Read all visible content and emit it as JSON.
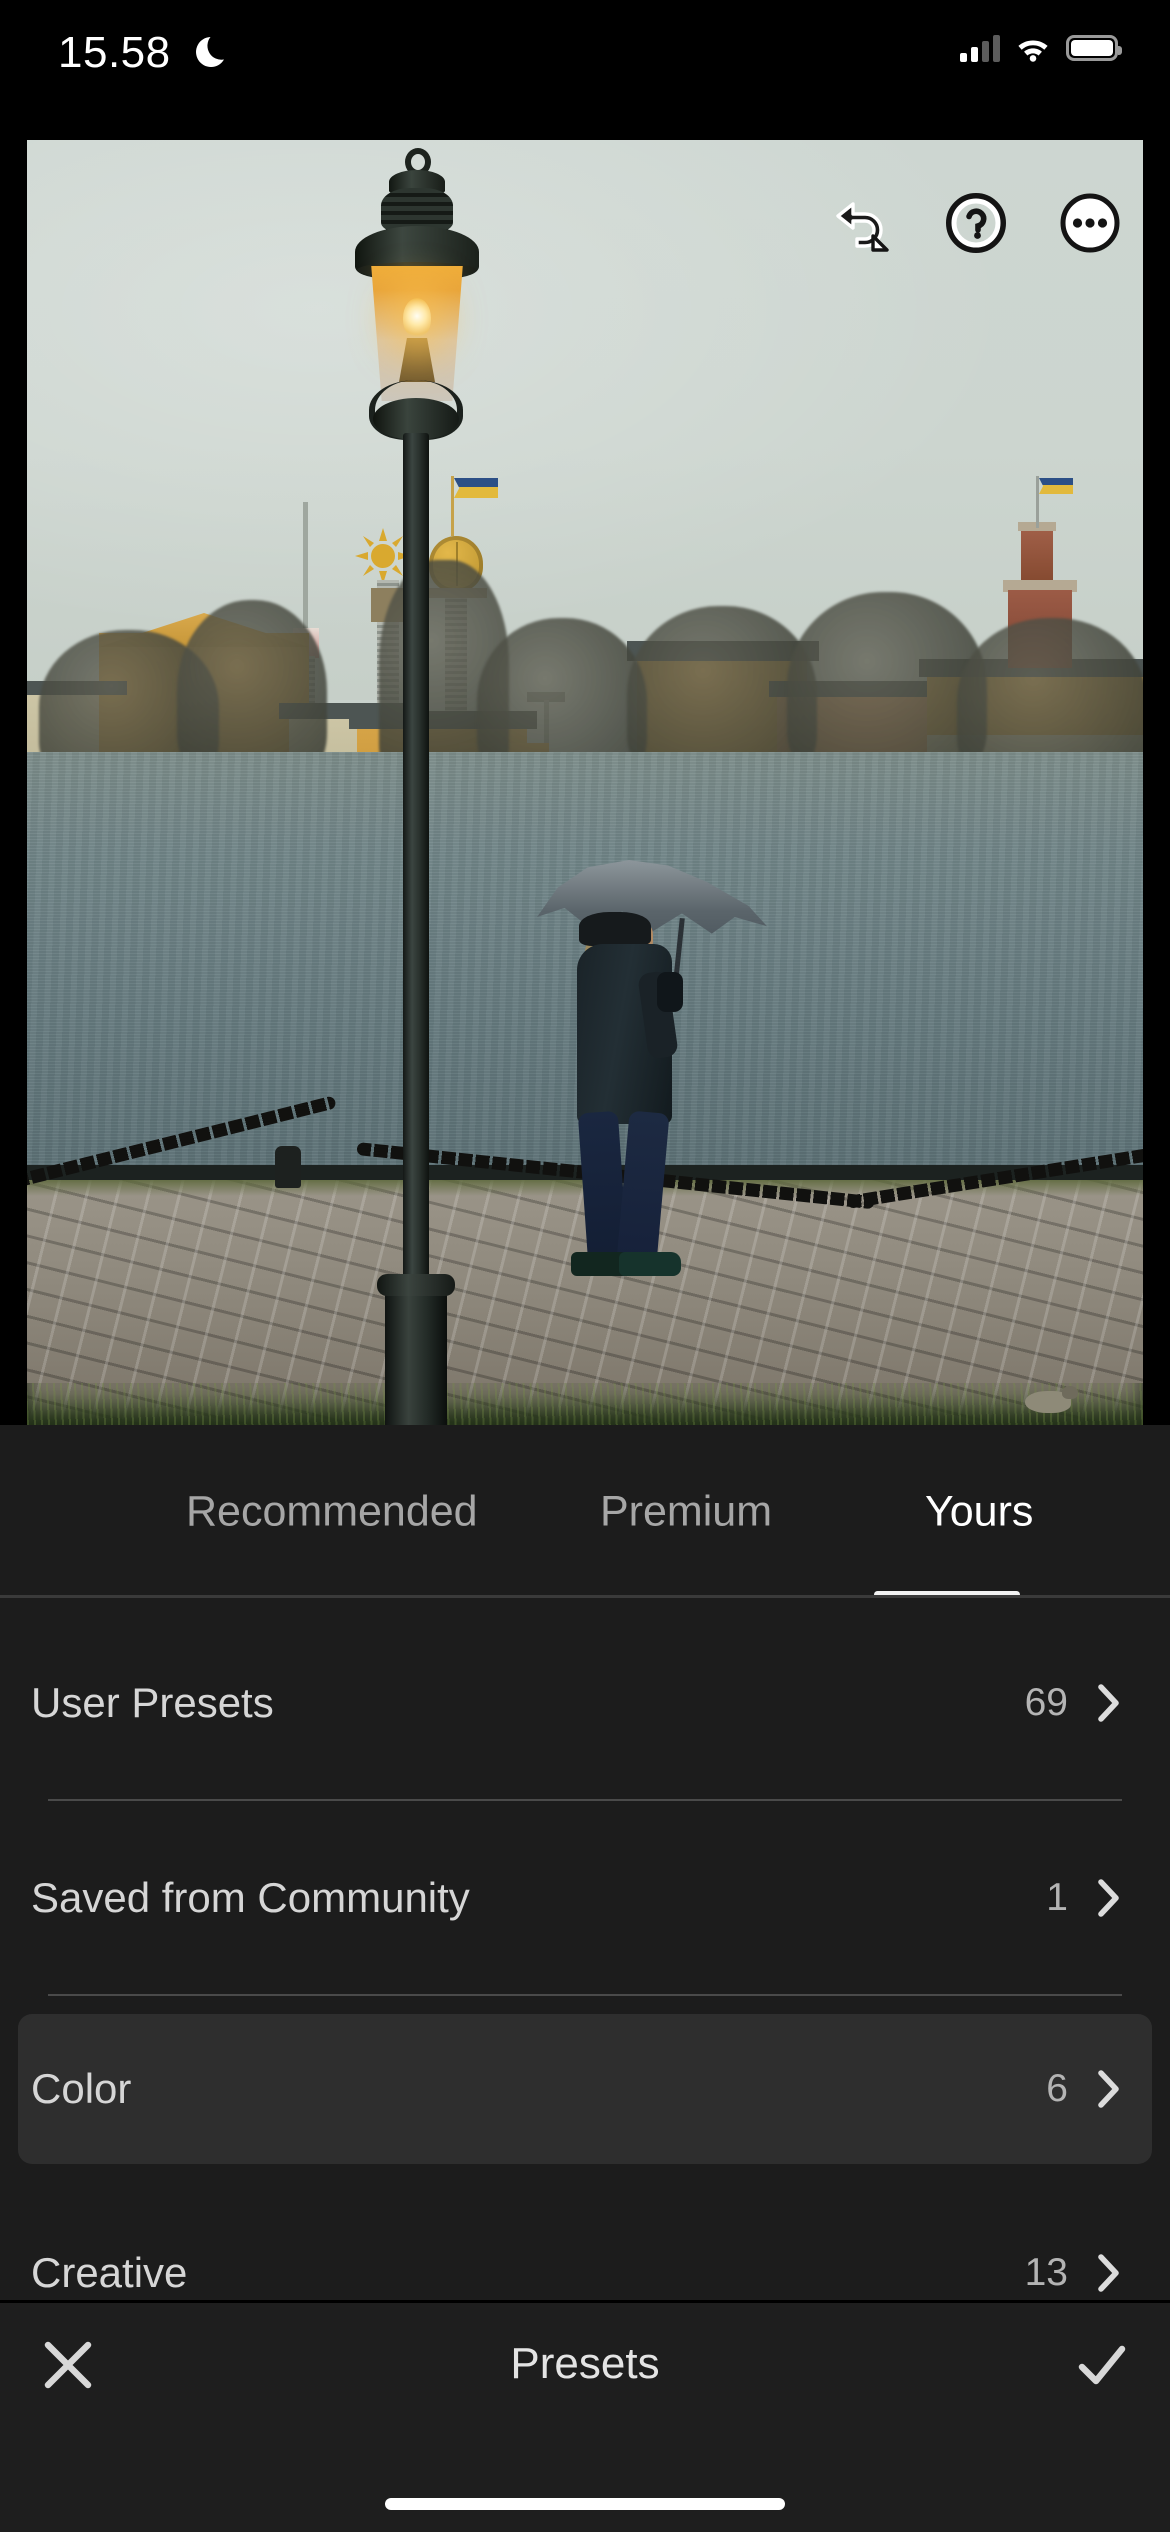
{
  "status_bar": {
    "time": "15.58",
    "dnd_icon": "crescent-moon-icon",
    "signal_icon": "cellular-signal-icon",
    "wifi_icon": "wifi-icon",
    "battery_icon": "battery-full-icon"
  },
  "photo": {
    "alt": "Lit street lamp on a rainy Stockholm quay, person with umbrella walking by the water",
    "tools": [
      {
        "name": "undo-icon",
        "label": "Undo"
      },
      {
        "name": "help-icon",
        "label": "Help"
      },
      {
        "name": "more-options-icon",
        "label": "More"
      }
    ],
    "sky_color": "#ccd5d0",
    "water_color": "#6c8185",
    "lamp_glow_color": "#ffc44e"
  },
  "tabs": [
    {
      "label": "Recommended",
      "active": false
    },
    {
      "label": "Premium",
      "active": false
    },
    {
      "label": "Yours",
      "active": true
    }
  ],
  "list": [
    {
      "label": "User Presets",
      "count": "69",
      "selected": false
    },
    {
      "label": "Saved from Community",
      "count": "1",
      "selected": false
    },
    {
      "label": "Color",
      "count": "6",
      "selected": true
    },
    {
      "label": "Creative",
      "count": "13",
      "selected": false
    }
  ],
  "bottom_bar": {
    "close_label": "Close",
    "title": "Presets",
    "done_label": "Done",
    "close_icon": "close-icon",
    "done_icon": "check-icon"
  },
  "colors": {
    "panel_bg": "#1c1c1c",
    "row_selected_bg": "#2e2e2e",
    "accent_white": "#ffffff",
    "muted_text": "#a6a6a6"
  }
}
